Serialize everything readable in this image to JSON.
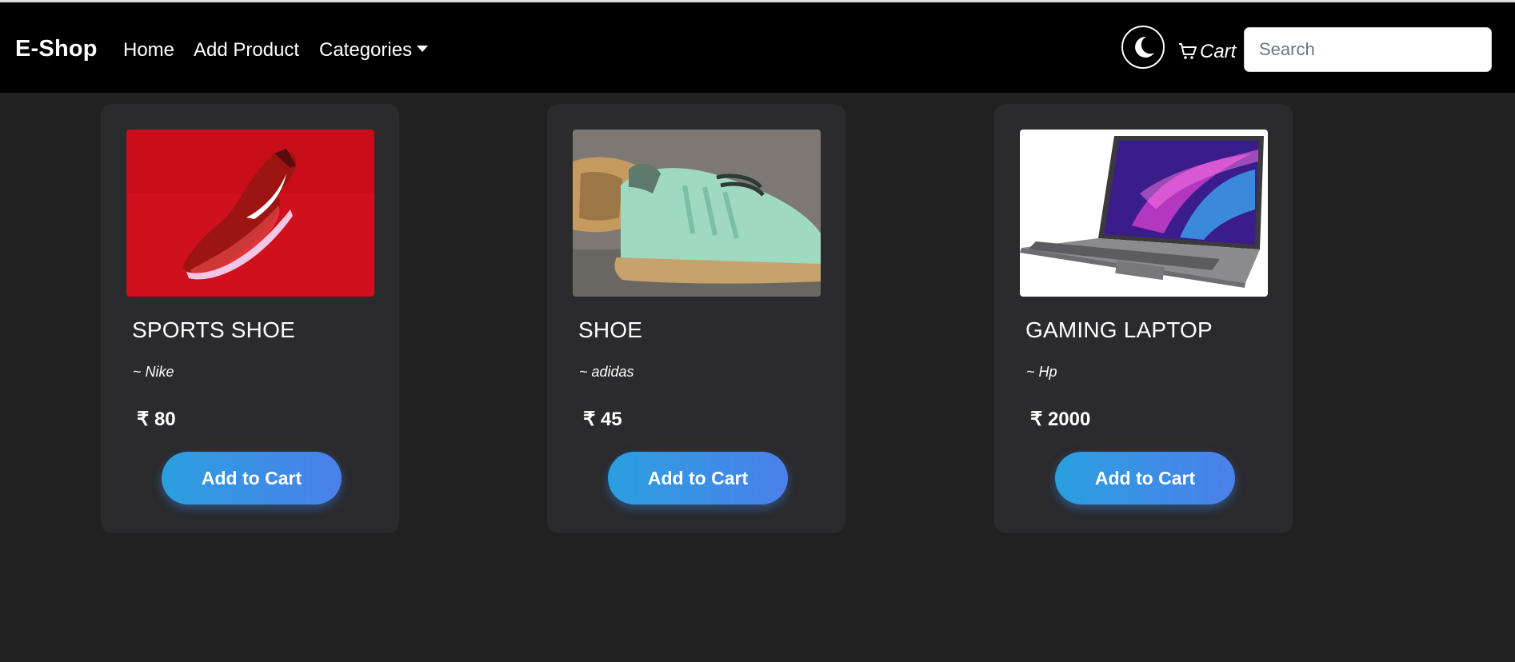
{
  "navbar": {
    "brand": "E-Shop",
    "links": [
      {
        "label": "Home"
      },
      {
        "label": "Add Product"
      },
      {
        "label": "Categories"
      }
    ],
    "cart_label": "Cart",
    "search_placeholder": "Search",
    "theme_icon": "moon-icon",
    "cart_icon": "cart-icon"
  },
  "products": [
    {
      "title": "SPORTS SHOE",
      "brand": "~ Nike",
      "price": "₹ 80",
      "button": "Add to Cart",
      "image": "red-sneaker"
    },
    {
      "title": "SHOE",
      "brand": "~ adidas",
      "price": "₹ 45",
      "button": "Add to Cart",
      "image": "mint-sneaker"
    },
    {
      "title": "GAMING LAPTOP",
      "brand": "~ Hp",
      "price": "₹ 2000",
      "button": "Add to Cart",
      "image": "laptop"
    }
  ],
  "colors": {
    "background": "#212121",
    "navbar": "#000000",
    "card": "#2b2a2d",
    "button_start": "#2a9fe0",
    "button_end": "#4b80ea"
  }
}
